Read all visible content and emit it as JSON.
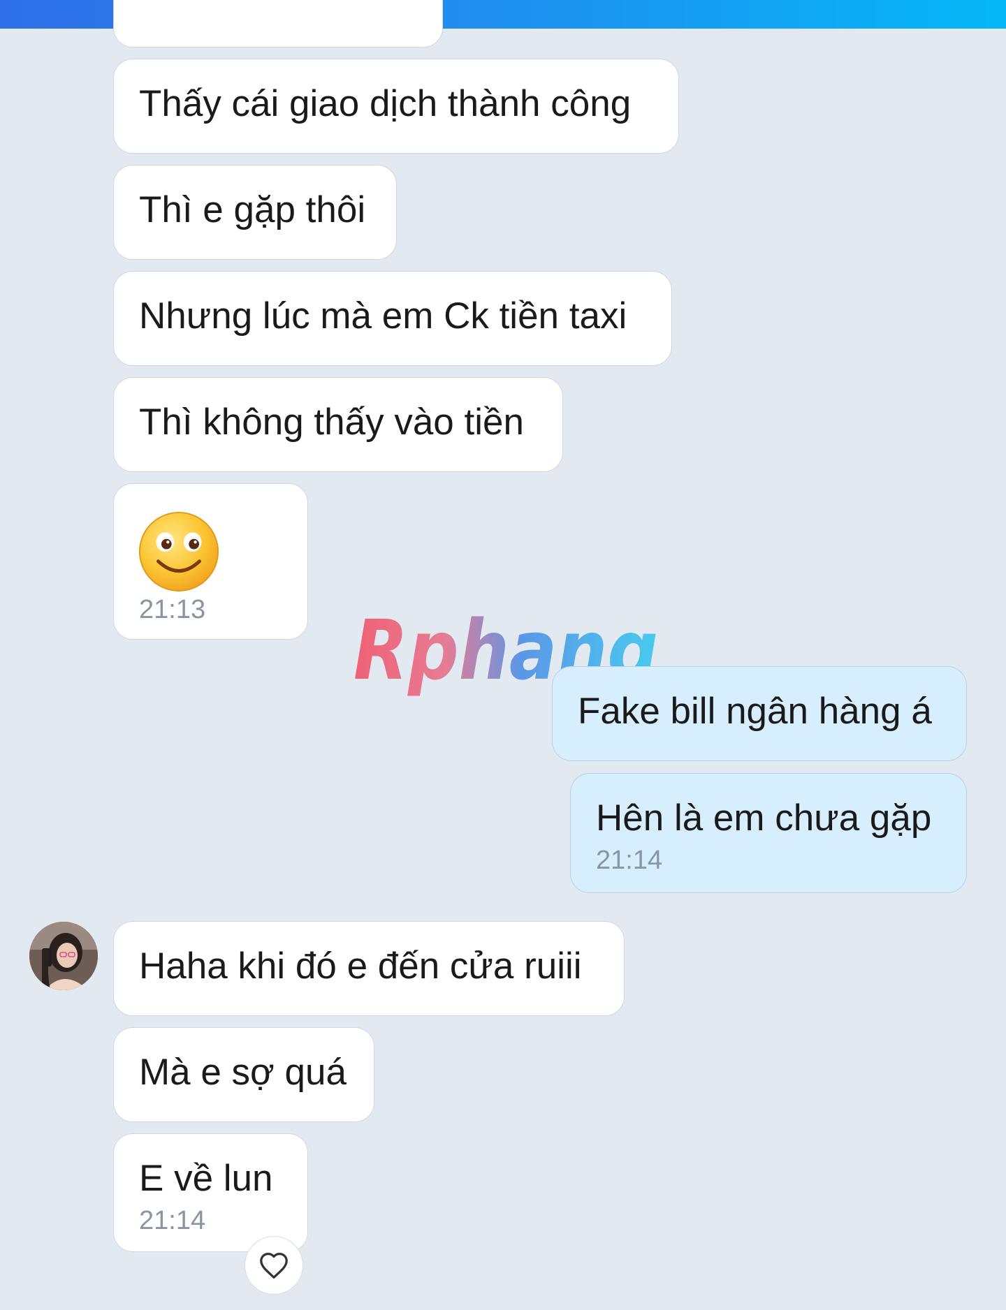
{
  "watermark": {
    "text": "Rphang"
  },
  "messages": [
    {
      "text": "Thấy cái giao dịch thành công"
    },
    {
      "text": "Thì e gặp thôi"
    },
    {
      "text": "Nhưng lúc mà em Ck tiền taxi"
    },
    {
      "text": "Thì không thấy vào tiền"
    },
    {
      "emoji": "slightly-smiling-face",
      "time": "21:13"
    },
    {
      "text": "Fake bill ngân hàng á"
    },
    {
      "text": "Hên là em chưa gặp",
      "time": "21:14"
    },
    {
      "text": "Haha khi đó e đến cửa ruiii"
    },
    {
      "text": "Mà e sợ quá"
    },
    {
      "text": "E về lun",
      "time": "21:14"
    }
  ],
  "colors": {
    "background": "#e3e9f1",
    "incoming_bubble": "#ffffff",
    "outgoing_bubble": "#d6eefd",
    "timestamp": "#8995a3",
    "top_bar_start": "#2f6fe8",
    "top_bar_end": "#05b7f7"
  },
  "icons": {
    "reaction": "heart-outline-icon",
    "avatar": "contact-avatar"
  }
}
